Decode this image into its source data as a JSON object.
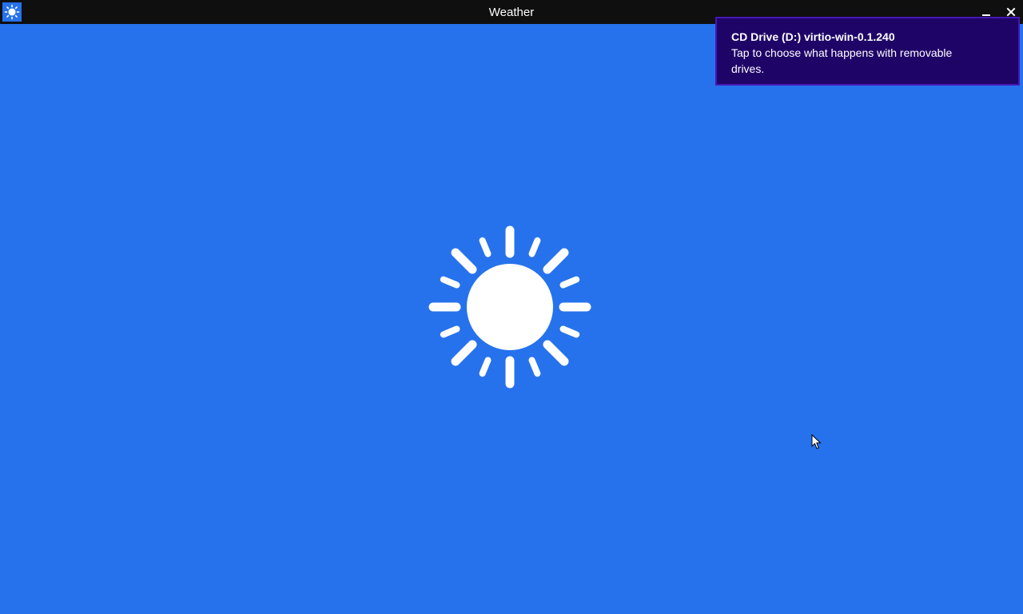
{
  "window": {
    "title": "Weather",
    "app_icon": "sun-icon",
    "controls": {
      "minimize_icon": "minimize-icon",
      "close_icon": "close-icon"
    }
  },
  "splash": {
    "icon": "sun-icon"
  },
  "toast": {
    "title": "CD Drive (D:) virtio-win-0.1.240",
    "body": "Tap to choose what happens with removable drives."
  },
  "colors": {
    "background": "#2672ec",
    "titlebar": "#0f0f0f",
    "toast_background": "#1f0468",
    "toast_border": "#4617b4",
    "foreground": "#ffffff"
  }
}
